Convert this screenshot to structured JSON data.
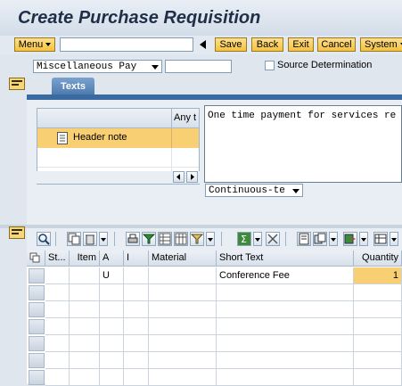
{
  "window": {
    "title": "Create Purchase Requisition"
  },
  "toolbar": {
    "menu_label": "Menu",
    "command_value": "",
    "buttons": [
      "Save",
      "Back",
      "Exit",
      "Cancel",
      "System"
    ]
  },
  "header": {
    "doc_type": "Miscellaneous Pay",
    "doc_number": "",
    "source_determination_label": "Source Determination",
    "source_determination_checked": false
  },
  "texts_section": {
    "tab_label": "Texts",
    "list_header_type": "Any t",
    "items": [
      {
        "label": "Header note",
        "selected": true
      }
    ],
    "editor_text": "One time payment for services re",
    "format_select": "Continuous-te"
  },
  "items_section": {
    "columns": [
      "St...",
      "Item",
      "A",
      "I",
      "Material",
      "Short Text",
      "Quantity"
    ],
    "rows": [
      {
        "status": "",
        "item": "",
        "acct": "U",
        "cat": "",
        "material": "",
        "short_text": "Conference Fee",
        "quantity": "1"
      }
    ]
  },
  "colors": {
    "accent": "#3b6aa0",
    "button": "#f5c13f",
    "highlight": "#f9cf73"
  }
}
